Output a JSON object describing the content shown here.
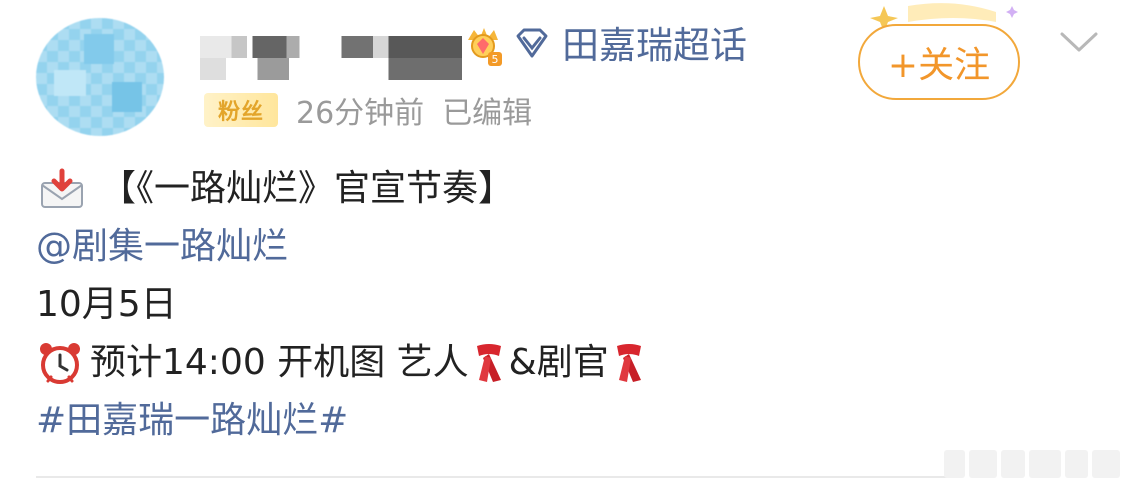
{
  "header": {
    "topic_name": "田嘉瑞超话",
    "follow_label": "+关注",
    "badge_level": "5",
    "meta": {
      "badge_text": "粉丝",
      "time": "26分钟前",
      "edited": "已编辑"
    }
  },
  "post": {
    "line1": "【《一路灿烂》官宣节奏】",
    "mention": "@剧集一路灿烂",
    "date": "10月5日",
    "schedule_prefix": "预计14:00 开机图 艺人",
    "schedule_mid": "&剧官",
    "hashtag": "#田嘉瑞一路灿烂#"
  },
  "icons": {
    "mail": "incoming-envelope-icon",
    "clock": "alarm-clock-icon",
    "scarf": "red-scarf-icon",
    "crown": "crown-badge-icon",
    "diamond": "diamond-icon",
    "chevron": "chevron-down-icon"
  },
  "colors": {
    "link": "#516a9a",
    "follow": "#f2962a",
    "meta": "#9a9a9a"
  }
}
